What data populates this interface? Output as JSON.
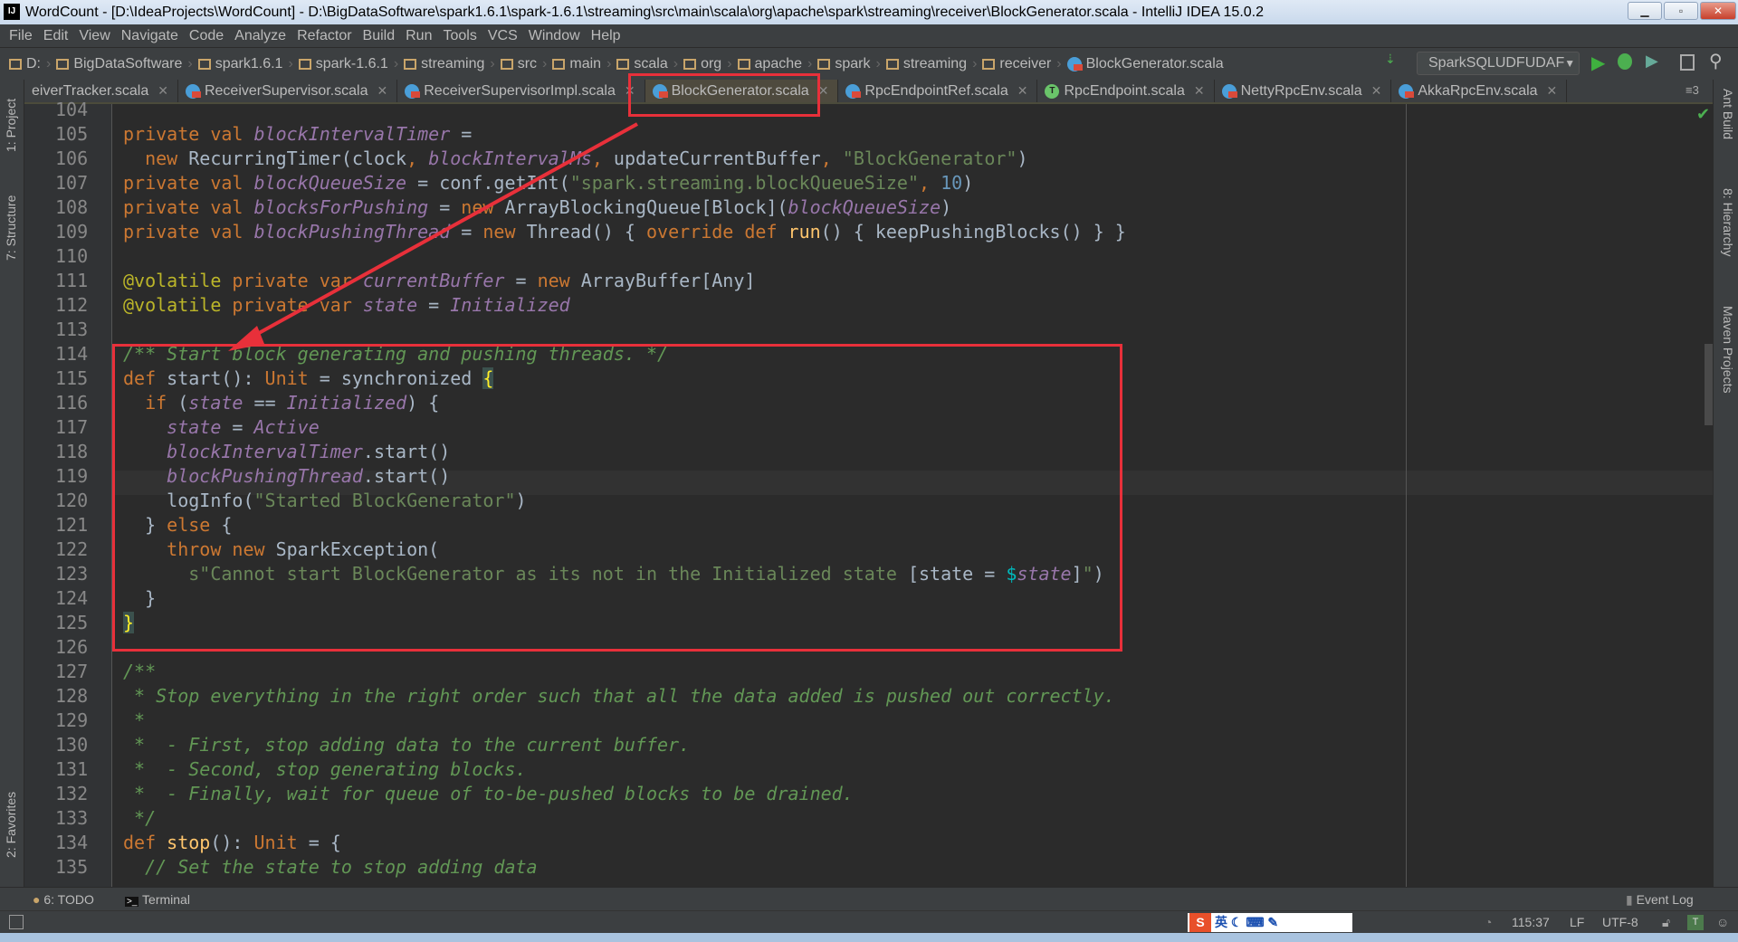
{
  "window": {
    "title": "WordCount - [D:\\IdeaProjects\\WordCount] - D:\\BigDataSoftware\\spark1.6.1\\spark-1.6.1\\streaming\\src\\main\\scala\\org\\apache\\spark\\streaming\\receiver\\BlockGenerator.scala - IntelliJ IDEA 15.0.2",
    "logo": "IJ"
  },
  "menu": [
    "File",
    "Edit",
    "View",
    "Navigate",
    "Code",
    "Analyze",
    "Refactor",
    "Build",
    "Run",
    "Tools",
    "VCS",
    "Window",
    "Help"
  ],
  "breadcrumb": [
    "D:",
    "BigDataSoftware",
    "spark1.6.1",
    "spark-1.6.1",
    "streaming",
    "src",
    "main",
    "scala",
    "org",
    "apache",
    "spark",
    "streaming",
    "receiver"
  ],
  "breadcrumb_file": "BlockGenerator.scala",
  "run_config": "SparkSQLUDFUDAF",
  "tabs": [
    {
      "label": "eiverTracker.scala",
      "icon": "scala-class"
    },
    {
      "label": "ReceiverSupervisor.scala",
      "icon": "scala-class"
    },
    {
      "label": "ReceiverSupervisorImpl.scala",
      "icon": "scala-class"
    },
    {
      "label": "BlockGenerator.scala",
      "icon": "scala-class",
      "active": true
    },
    {
      "label": "RpcEndpointRef.scala",
      "icon": "scala-class"
    },
    {
      "label": "RpcEndpoint.scala",
      "icon": "scala-trait"
    },
    {
      "label": "NettyRpcEnv.scala",
      "icon": "scala-class"
    },
    {
      "label": "AkkaRpcEnv.scala",
      "icon": "scala-class"
    }
  ],
  "tab_overflow": "3",
  "left_tools": [
    "1: Project",
    "7: Structure",
    "2: Favorites"
  ],
  "right_tools": [
    "Ant Build",
    "8: Hierarchy",
    "Maven Projects"
  ],
  "code": {
    "first_line": 104,
    "current_line": 115,
    "lines": [
      [],
      [
        [
          "kw",
          "private val "
        ],
        [
          "iv",
          "blockIntervalTimer"
        ],
        [
          "tx",
          " ="
        ]
      ],
      [
        [
          "tx",
          "  "
        ],
        [
          "kw",
          "new "
        ],
        [
          "tx",
          "RecurringTimer(clock"
        ],
        [
          "kw",
          ", "
        ],
        [
          "iv",
          "blockIntervalMs"
        ],
        [
          "kw",
          ", "
        ],
        [
          "tx",
          "updateCurrentBuffer"
        ],
        [
          "kw",
          ", "
        ],
        [
          "st",
          "\"BlockGenerator\""
        ],
        [
          "tx",
          ")"
        ]
      ],
      [
        [
          "kw",
          "private val "
        ],
        [
          "iv",
          "blockQueueSize"
        ],
        [
          "tx",
          " = conf.getInt("
        ],
        [
          "st",
          "\"spark.streaming.blockQueueSize\""
        ],
        [
          "kw",
          ", "
        ],
        [
          "nu",
          "10"
        ],
        [
          "tx",
          ")"
        ]
      ],
      [
        [
          "kw",
          "private val "
        ],
        [
          "iv",
          "blocksForPushing"
        ],
        [
          "tx",
          " = "
        ],
        [
          "kw",
          "new "
        ],
        [
          "tx",
          "ArrayBlockingQueue[Block]("
        ],
        [
          "iv",
          "blockQueueSize"
        ],
        [
          "tx",
          ")"
        ]
      ],
      [
        [
          "kw",
          "private val "
        ],
        [
          "iv",
          "blockPushingThread"
        ],
        [
          "tx",
          " = "
        ],
        [
          "kw",
          "new "
        ],
        [
          "tx",
          "Thread() { "
        ],
        [
          "kw",
          "override def "
        ],
        [
          "fn",
          "run"
        ],
        [
          "tx",
          "() { keepPushingBlocks() } }"
        ]
      ],
      [],
      [
        [
          "an",
          "@volatile "
        ],
        [
          "kw",
          "private var "
        ],
        [
          "iv",
          "currentBuffer"
        ],
        [
          "tx",
          " = "
        ],
        [
          "kw",
          "new "
        ],
        [
          "tx",
          "ArrayBuffer[Any]"
        ]
      ],
      [
        [
          "an",
          "@volatile "
        ],
        [
          "kw",
          "private var "
        ],
        [
          "iv",
          "state"
        ],
        [
          "tx",
          " = "
        ],
        [
          "iv",
          "Initialized"
        ]
      ],
      [],
      [
        [
          "cm",
          "/** Start block generating and pushing threads. */"
        ]
      ],
      [
        [
          "kw",
          "def "
        ],
        [
          "tx",
          "start(): "
        ],
        [
          "kw",
          "Unit"
        ],
        [
          "tx",
          " = synchronized "
        ],
        [
          "br",
          "{"
        ]
      ],
      [
        [
          "tx",
          "  "
        ],
        [
          "kw",
          "if "
        ],
        [
          "tx",
          "("
        ],
        [
          "iv",
          "state"
        ],
        [
          "tx",
          " == "
        ],
        [
          "iv",
          "Initialized"
        ],
        [
          "tx",
          ") {"
        ]
      ],
      [
        [
          "tx",
          "    "
        ],
        [
          "iv",
          "state"
        ],
        [
          "tx",
          " = "
        ],
        [
          "iv",
          "Active"
        ]
      ],
      [
        [
          "tx",
          "    "
        ],
        [
          "iv",
          "blockIntervalTimer"
        ],
        [
          "tx",
          ".start()"
        ]
      ],
      [
        [
          "tx",
          "    "
        ],
        [
          "iv",
          "blockPushingThread"
        ],
        [
          "tx",
          ".start()"
        ]
      ],
      [
        [
          "tx",
          "    logInfo("
        ],
        [
          "st",
          "\"Started BlockGenerator\""
        ],
        [
          "tx",
          ")"
        ]
      ],
      [
        [
          "tx",
          "  } "
        ],
        [
          "kw",
          "else "
        ],
        [
          "tx",
          "{"
        ]
      ],
      [
        [
          "tx",
          "    "
        ],
        [
          "kw",
          "throw new "
        ],
        [
          "tx",
          "SparkException("
        ]
      ],
      [
        [
          "tx",
          "      "
        ],
        [
          "st",
          "s\"Cannot start BlockGenerator as its not in the Initialized state "
        ],
        [
          "tx",
          "[state = "
        ],
        [
          "dl",
          "$"
        ],
        [
          "iv",
          "state"
        ],
        [
          "tx",
          "]"
        ],
        [
          "st",
          "\""
        ],
        [
          "tx",
          ")"
        ]
      ],
      [
        [
          "tx",
          "  }"
        ]
      ],
      [
        [
          "br",
          "}"
        ]
      ],
      [],
      [
        [
          "cm",
          "/**"
        ]
      ],
      [
        [
          "cm",
          " * Stop everything in the right order such that all the data added is pushed out correctly."
        ]
      ],
      [
        [
          "cm",
          " *"
        ]
      ],
      [
        [
          "cm",
          " *  - First, stop adding data to the current buffer."
        ]
      ],
      [
        [
          "cm",
          " *  - Second, stop generating blocks."
        ]
      ],
      [
        [
          "cm",
          " *  - Finally, wait for queue of to-be-pushed blocks to be drained."
        ]
      ],
      [
        [
          "cm",
          " */"
        ]
      ],
      [
        [
          "kw",
          "def "
        ],
        [
          "fn",
          "stop"
        ],
        [
          "tx",
          "(): "
        ],
        [
          "kw",
          "Unit"
        ],
        [
          "tx",
          " = {"
        ]
      ],
      [
        [
          "tx",
          "  "
        ],
        [
          "cm",
          "// Set the state to stop adding data"
        ]
      ]
    ]
  },
  "bottom_tools": {
    "todo": "6: TODO",
    "terminal": "Terminal",
    "event_log": "Event Log"
  },
  "status": {
    "position": "115:37",
    "line_sep": "LF",
    "encoding": "UTF-8",
    "ime": "英"
  },
  "colors": {
    "annotation_box": "#e8303a",
    "keyword": "#cc7832",
    "string": "#6a8759",
    "field": "#9876aa",
    "comment": "#629755"
  }
}
